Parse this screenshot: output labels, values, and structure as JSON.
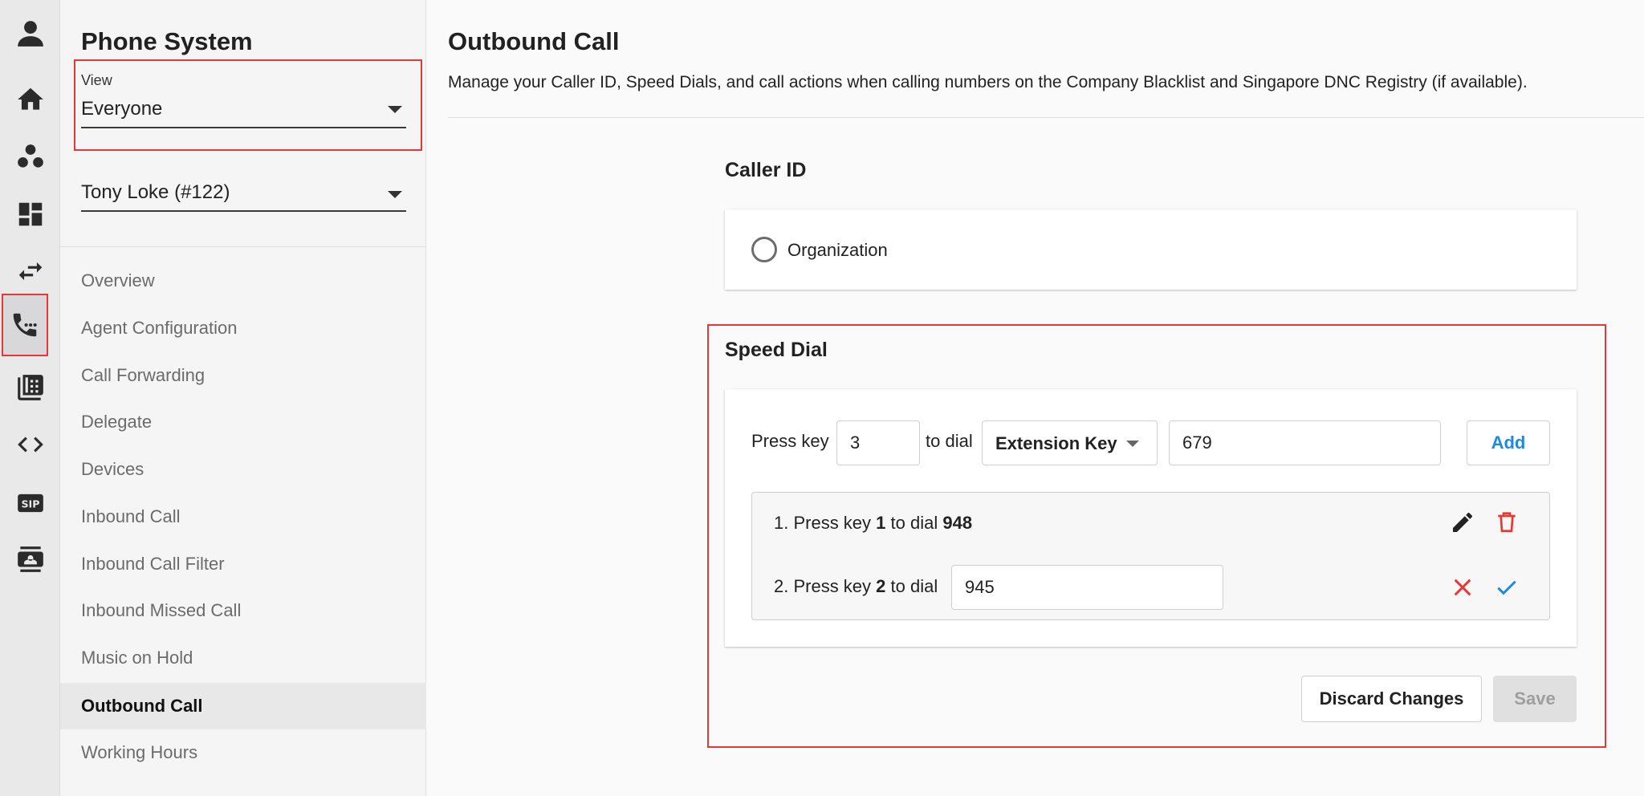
{
  "rail": {
    "items": [
      {
        "icon": "user-icon"
      },
      {
        "icon": "home-icon"
      },
      {
        "icon": "groups-icon"
      },
      {
        "icon": "dashboard-icon"
      },
      {
        "icon": "swap-icon"
      },
      {
        "icon": "phone-dialpad-icon",
        "active": true
      },
      {
        "icon": "phone-system-icon"
      },
      {
        "icon": "code-icon"
      },
      {
        "icon": "sip-icon",
        "text": "SIP"
      },
      {
        "icon": "contact-card-icon"
      }
    ]
  },
  "sidebar": {
    "title": "Phone System",
    "view_label": "View",
    "view_value": "Everyone",
    "user_value": "Tony Loke (#122)",
    "nav": [
      {
        "label": "Overview"
      },
      {
        "label": "Agent Configuration"
      },
      {
        "label": "Call Forwarding"
      },
      {
        "label": "Delegate"
      },
      {
        "label": "Devices"
      },
      {
        "label": "Inbound Call"
      },
      {
        "label": "Inbound Call Filter"
      },
      {
        "label": "Inbound Missed Call"
      },
      {
        "label": "Music on Hold"
      },
      {
        "label": "Outbound Call",
        "active": true
      },
      {
        "label": "Working Hours"
      }
    ]
  },
  "main": {
    "title": "Outbound Call",
    "description": "Manage your Caller ID, Speed Dials, and call actions when calling numbers on the Company Blacklist and Singapore DNC Registry (if available).",
    "caller_id": {
      "title": "Caller ID",
      "option_label": "Organization"
    },
    "speed_dial": {
      "title": "Speed Dial",
      "press_key_label": "Press key",
      "key_value": "3",
      "to_dial_label": "to dial",
      "type_value": "Extension Key",
      "number_value": "679",
      "add_label": "Add",
      "entries": [
        {
          "prefix": "1. Press key ",
          "key": "1",
          "mid": " to dial ",
          "number": "948"
        },
        {
          "prefix": "2. Press key ",
          "key": "2",
          "mid": " to dial",
          "edit_value": "945"
        }
      ]
    },
    "actions": {
      "discard_label": "Discard Changes",
      "save_label": "Save"
    }
  },
  "colors": {
    "accent": "#1e88e5",
    "danger": "#e53935",
    "highlight_border": "#e53935"
  }
}
